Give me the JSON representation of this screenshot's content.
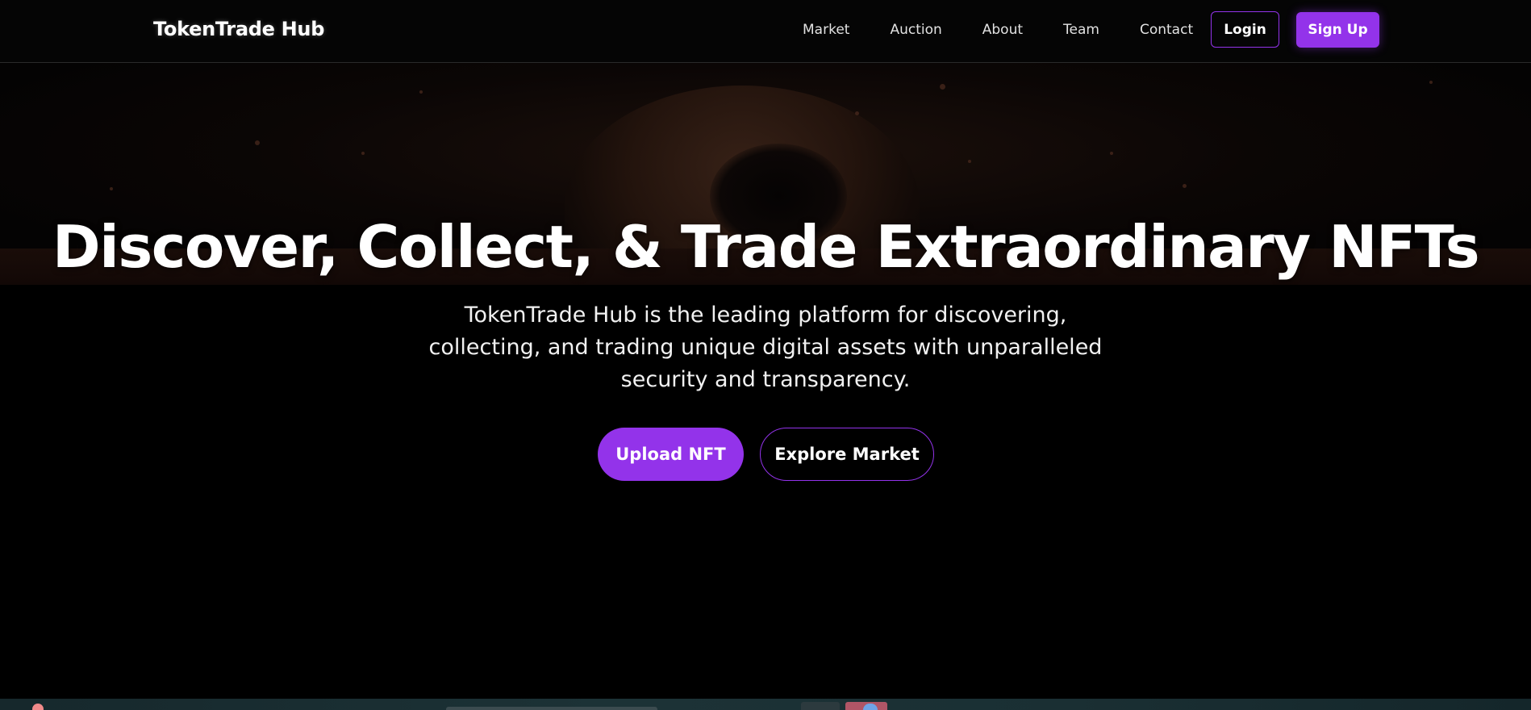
{
  "navbar": {
    "brand": "TokenTrade Hub",
    "links": [
      "Market",
      "Auction",
      "About",
      "Team",
      "Contact"
    ],
    "login_label": "Login",
    "signup_label": "Sign Up"
  },
  "hero": {
    "title": "Discover, Collect, & Trade Extraordinary NFTs",
    "subtitle": "TokenTrade Hub is the leading platform for discovering, collecting, and trading unique digital assets with unparalleled security and transparency.",
    "primary_button": "Upload NFT",
    "secondary_button": "Explore Market",
    "background_image": "astronaut-helmet"
  },
  "colors": {
    "accent": "#9333ea",
    "background": "#000000",
    "text": "#ffffff"
  }
}
